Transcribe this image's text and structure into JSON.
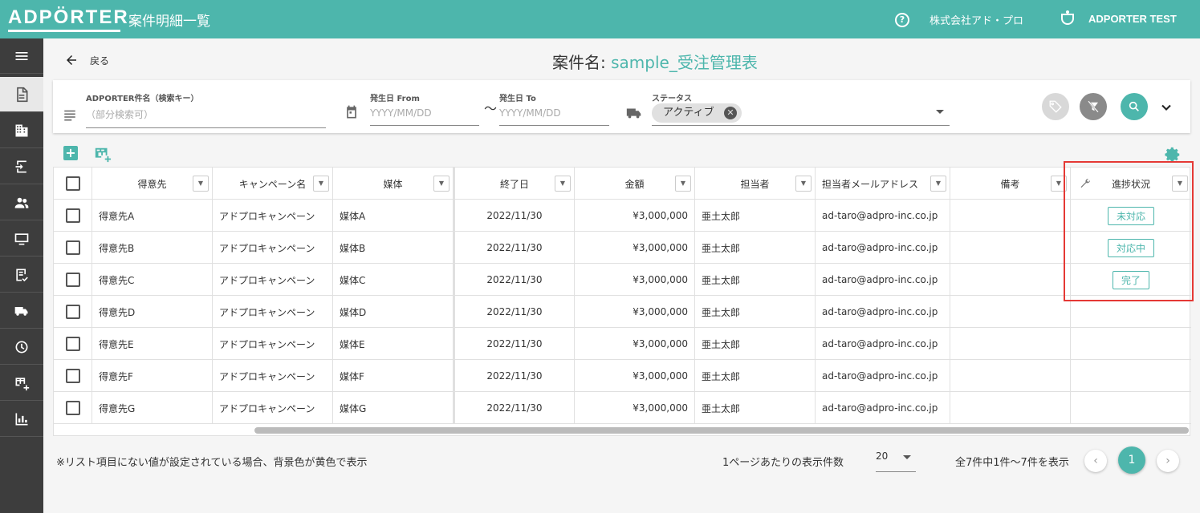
{
  "header": {
    "logo": "ADPÖRTER",
    "title": "案件明細一覧",
    "company": "株式会社アド・プロ",
    "user": "ADPORTER TEST"
  },
  "sidebar": {
    "items": [
      "menu-icon",
      "document-icon",
      "building-icon",
      "import-icon",
      "people-icon",
      "monitor-icon",
      "checklist-icon",
      "truck-icon",
      "history-icon",
      "table-add-icon",
      "bar-chart-icon"
    ]
  },
  "nav": {
    "back_label": "戻る"
  },
  "page": {
    "title_prefix": "案件名: ",
    "title_name": "sample_受注管理表"
  },
  "filter": {
    "search_key_label": "ADPORTER件名（検索キー）",
    "search_key_placeholder": "（部分検索可）",
    "date_from_label": "発生日 From",
    "date_from_placeholder": "YYYY/MM/DD",
    "tilde": "〜",
    "date_to_label": "発生日 To",
    "date_to_placeholder": "YYYY/MM/DD",
    "status_label": "ステータス",
    "status_chip": "アクティブ"
  },
  "table": {
    "headers": [
      "得意先",
      "キャンペーン名",
      "媒体",
      "終了日",
      "金額",
      "担当者",
      "担当者メールアドレス",
      "備考",
      "進捗状況"
    ],
    "rows": [
      {
        "client": "得意先A",
        "campaign": "アドプロキャンペーン",
        "media": "媒体A",
        "end": "2022/11/30",
        "amount": "¥3,000,000",
        "owner": "亜土太郎",
        "email": "ad-taro@adpro-inc.co.jp",
        "note": "",
        "status": "未対応"
      },
      {
        "client": "得意先B",
        "campaign": "アドプロキャンペーン",
        "media": "媒体B",
        "end": "2022/11/30",
        "amount": "¥3,000,000",
        "owner": "亜土太郎",
        "email": "ad-taro@adpro-inc.co.jp",
        "note": "",
        "status": "対応中"
      },
      {
        "client": "得意先C",
        "campaign": "アドプロキャンペーン",
        "media": "媒体C",
        "end": "2022/11/30",
        "amount": "¥3,000,000",
        "owner": "亜土太郎",
        "email": "ad-taro@adpro-inc.co.jp",
        "note": "",
        "status": "完了"
      },
      {
        "client": "得意先D",
        "campaign": "アドプロキャンペーン",
        "media": "媒体D",
        "end": "2022/11/30",
        "amount": "¥3,000,000",
        "owner": "亜土太郎",
        "email": "ad-taro@adpro-inc.co.jp",
        "note": "",
        "status": ""
      },
      {
        "client": "得意先E",
        "campaign": "アドプロキャンペーン",
        "media": "媒体E",
        "end": "2022/11/30",
        "amount": "¥3,000,000",
        "owner": "亜土太郎",
        "email": "ad-taro@adpro-inc.co.jp",
        "note": "",
        "status": ""
      },
      {
        "client": "得意先F",
        "campaign": "アドプロキャンペーン",
        "media": "媒体F",
        "end": "2022/11/30",
        "amount": "¥3,000,000",
        "owner": "亜土太郎",
        "email": "ad-taro@adpro-inc.co.jp",
        "note": "",
        "status": ""
      },
      {
        "client": "得意先G",
        "campaign": "アドプロキャンペーン",
        "media": "媒体G",
        "end": "2022/11/30",
        "amount": "¥3,000,000",
        "owner": "亜土太郎",
        "email": "ad-taro@adpro-inc.co.jp",
        "note": "",
        "status": ""
      }
    ]
  },
  "footer": {
    "note": "※リスト項目にない値が設定されている場合、背景色が黄色で表示",
    "per_page_label": "1ページあたりの表示件数",
    "per_page_value": "20",
    "range": "全7件中1件〜7件を表示",
    "current_page": "1"
  },
  "colors": {
    "accent": "#4db6ac",
    "sidebar": "#3d3d3d",
    "highlight": "#e53935"
  }
}
